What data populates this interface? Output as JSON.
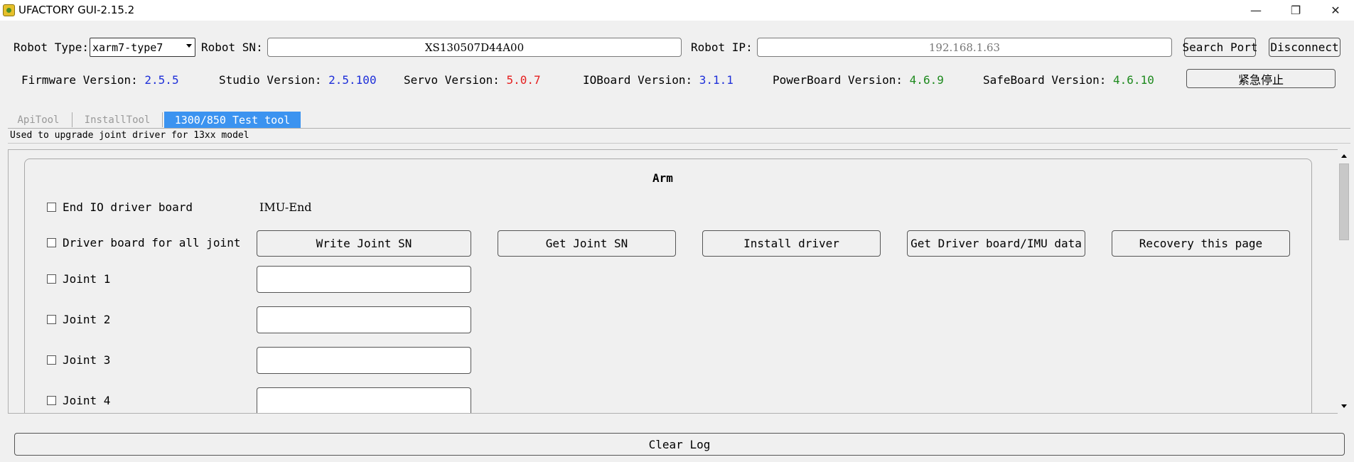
{
  "window": {
    "title": "UFACTORY GUI-2.15.2",
    "minimize_glyph": "—",
    "maximize_glyph": "❐",
    "close_glyph": "✕"
  },
  "header": {
    "robot_type_label": "Robot Type:",
    "robot_type_value": "xarm7-type7",
    "robot_sn_label": "Robot SN:",
    "robot_sn_value": "XS130507D44A00",
    "robot_ip_label": "Robot IP:",
    "robot_ip_value": "192.168.1.63",
    "search_port_label": "Search Port",
    "disconnect_label": "Disconnect"
  },
  "versions": {
    "firmware_label": "Firmware Version:",
    "firmware_value": "2.5.5",
    "studio_label": "Studio Version:",
    "studio_value": "2.5.100",
    "servo_label": "Servo Version:",
    "servo_value": "5.0.7",
    "ioboard_label": "IOBoard Version:",
    "ioboard_value": "3.1.1",
    "powerboard_label": "PowerBoard Version:",
    "powerboard_value": "4.6.9",
    "safeboard_label": "SafeBoard Version:",
    "safeboard_value": "4.6.10",
    "estop_label": "紧急停止"
  },
  "tabs": [
    {
      "label": "ApiTool",
      "active": false
    },
    {
      "label": "InstallTool",
      "active": false
    },
    {
      "label": "1300/850 Test tool",
      "active": true
    }
  ],
  "description": "Used to upgrade joint driver for 13xx model",
  "arm_panel": {
    "title": "Arm",
    "end_io_label": "End IO driver board",
    "imu_label": "IMU-End",
    "all_joint_label": "Driver board for all joint",
    "buttons": {
      "write_sn": "Write Joint SN",
      "get_sn": "Get Joint SN",
      "install_driver": "Install driver",
      "get_imu": "Get Driver board/IMU data",
      "recovery": "Recovery this page"
    },
    "joints": [
      {
        "label": "Joint 1",
        "value": ""
      },
      {
        "label": "Joint 2",
        "value": ""
      },
      {
        "label": "Joint 3",
        "value": ""
      },
      {
        "label": "Joint 4",
        "value": ""
      }
    ]
  },
  "footer": {
    "clear_log_label": "Clear Log"
  }
}
